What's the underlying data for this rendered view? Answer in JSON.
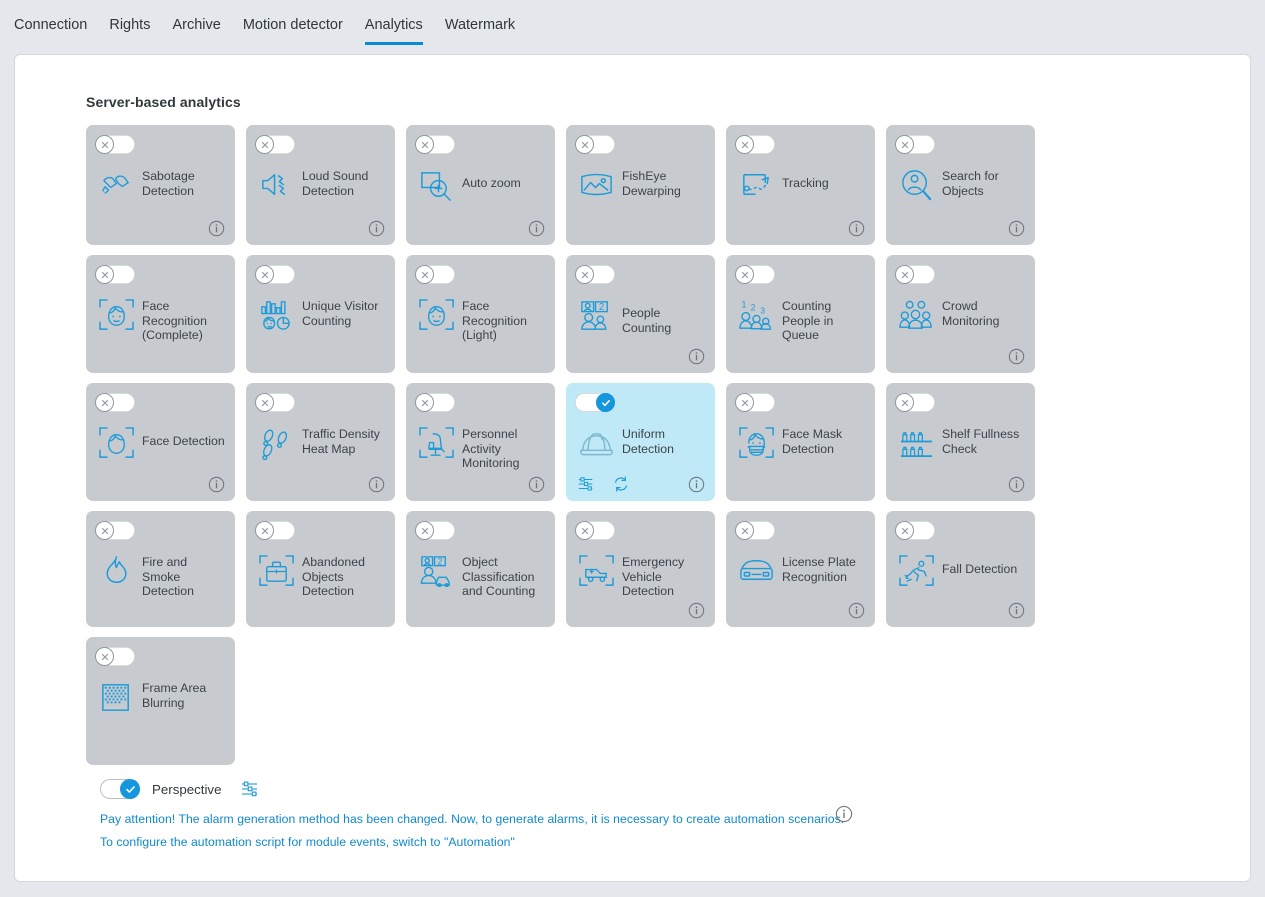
{
  "tabs": [
    {
      "label": "Connection",
      "active": false
    },
    {
      "label": "Rights",
      "active": false
    },
    {
      "label": "Archive",
      "active": false
    },
    {
      "label": "Motion detector",
      "active": false
    },
    {
      "label": "Analytics",
      "active": true
    },
    {
      "label": "Watermark",
      "active": false
    }
  ],
  "section": {
    "title": "Server-based analytics"
  },
  "colors": {
    "accent": "#0a8cd2",
    "icon_blue": "#1d9bd8",
    "card_bg": "#c7cbd0",
    "card_active_bg": "#bfe9f7",
    "page_bg": "#e4e8ec",
    "text": "#3c4248",
    "link": "#1089cc"
  },
  "cards": [
    {
      "id": "sabotage-detection",
      "label": "Sabotage Detection",
      "icon": "sabotage-icon",
      "enabled": false,
      "info": true,
      "settings": false,
      "refresh": false,
      "height": "h120"
    },
    {
      "id": "loud-sound-detection",
      "label": "Loud Sound Detection",
      "icon": "loud-sound-icon",
      "enabled": false,
      "info": true,
      "settings": false,
      "refresh": false,
      "height": "h120"
    },
    {
      "id": "auto-zoom",
      "label": "Auto zoom",
      "icon": "auto-zoom-icon",
      "enabled": false,
      "info": true,
      "settings": false,
      "refresh": false,
      "height": "h120"
    },
    {
      "id": "fisheye-dewarping",
      "label": "FishEye Dewarping",
      "icon": "fisheye-icon",
      "enabled": false,
      "info": false,
      "settings": false,
      "refresh": false,
      "height": "h120"
    },
    {
      "id": "tracking",
      "label": "Tracking",
      "icon": "tracking-icon",
      "enabled": false,
      "info": true,
      "settings": false,
      "refresh": false,
      "height": "h120"
    },
    {
      "id": "search-for-objects",
      "label": "Search for Objects",
      "icon": "search-objects-icon",
      "enabled": false,
      "info": true,
      "settings": false,
      "refresh": false,
      "height": "h120"
    },
    {
      "id": "face-recognition-complete",
      "label": "Face Recognition (Complete)",
      "icon": "face-frame-icon",
      "enabled": false,
      "info": false,
      "settings": false,
      "refresh": false,
      "height": "h118"
    },
    {
      "id": "unique-visitor-counting",
      "label": "Unique Visitor Counting",
      "icon": "unique-visitor-icon",
      "enabled": false,
      "info": false,
      "settings": false,
      "refresh": false,
      "height": "h118"
    },
    {
      "id": "face-recognition-light",
      "label": "Face Recognition (Light)",
      "icon": "face-frame-icon",
      "enabled": false,
      "info": false,
      "settings": false,
      "refresh": false,
      "height": "h118"
    },
    {
      "id": "people-counting",
      "label": "People Counting",
      "icon": "people-counting-icon",
      "enabled": false,
      "info": true,
      "settings": false,
      "refresh": false,
      "height": "h118"
    },
    {
      "id": "counting-people-in-queue",
      "label": "Counting People in Queue",
      "icon": "queue-counting-icon",
      "enabled": false,
      "info": false,
      "settings": false,
      "refresh": false,
      "height": "h118"
    },
    {
      "id": "crowd-monitoring",
      "label": "Crowd Monitoring",
      "icon": "crowd-icon",
      "enabled": false,
      "info": true,
      "settings": false,
      "refresh": false,
      "height": "h118"
    },
    {
      "id": "face-detection",
      "label": "Face Detection",
      "icon": "face-frame-plain-icon",
      "enabled": false,
      "info": true,
      "settings": false,
      "refresh": false,
      "height": "h118"
    },
    {
      "id": "traffic-density-heat-map",
      "label": "Traffic Density Heat Map",
      "icon": "footsteps-icon",
      "enabled": false,
      "info": true,
      "settings": false,
      "refresh": false,
      "height": "h118"
    },
    {
      "id": "personnel-activity-monitoring",
      "label": "Personnel Activity Monitoring",
      "icon": "chair-frame-icon",
      "enabled": false,
      "info": true,
      "settings": false,
      "refresh": false,
      "height": "h118"
    },
    {
      "id": "uniform-detection",
      "label": "Uniform Detection",
      "icon": "helmet-icon",
      "enabled": true,
      "info": true,
      "settings": true,
      "refresh": true,
      "height": "h118"
    },
    {
      "id": "face-mask-detection",
      "label": "Face Mask Detection",
      "icon": "face-mask-icon",
      "enabled": false,
      "info": false,
      "settings": false,
      "refresh": false,
      "height": "h118"
    },
    {
      "id": "shelf-fullness-check",
      "label": "Shelf Fullness Check",
      "icon": "shelf-icon",
      "enabled": false,
      "info": true,
      "settings": false,
      "refresh": false,
      "height": "h118"
    },
    {
      "id": "fire-and-smoke-detection",
      "label": "Fire and Smoke Detection",
      "icon": "flame-icon",
      "enabled": false,
      "info": false,
      "settings": false,
      "refresh": false,
      "height": "h116"
    },
    {
      "id": "abandoned-objects-detection",
      "label": "Abandoned Objects Detection",
      "icon": "suitcase-frame-icon",
      "enabled": false,
      "info": false,
      "settings": false,
      "refresh": false,
      "height": "h116"
    },
    {
      "id": "object-classification-and-counting",
      "label": "Object Classification and Counting",
      "icon": "object-classification-icon",
      "enabled": false,
      "info": false,
      "settings": false,
      "refresh": false,
      "height": "h116"
    },
    {
      "id": "emergency-vehicle-detection",
      "label": "Emergency Vehicle Detection",
      "icon": "ambulance-frame-icon",
      "enabled": false,
      "info": true,
      "settings": false,
      "refresh": false,
      "height": "h116"
    },
    {
      "id": "license-plate-recognition",
      "label": "License Plate Recognition",
      "icon": "car-icon",
      "enabled": false,
      "info": true,
      "settings": false,
      "refresh": false,
      "height": "h116"
    },
    {
      "id": "fall-detection",
      "label": "Fall Detection",
      "icon": "fall-frame-icon",
      "enabled": false,
      "info": true,
      "settings": false,
      "refresh": false,
      "height": "h116"
    },
    {
      "id": "frame-area-blurring",
      "label": "Frame Area Blurring",
      "icon": "blur-icon",
      "enabled": false,
      "info": false,
      "settings": false,
      "refresh": false,
      "height": "h128"
    }
  ],
  "perspective": {
    "label": "Perspective",
    "enabled": true,
    "settings_icon": "sliders-icon"
  },
  "notices": {
    "line1": "Pay attention! The alarm generation method has been changed. Now, to generate alarms, it is necessary to create automation scenarios.",
    "line2": "To configure the automation script for module events, switch to \"Automation\"",
    "info_icon": "info-icon"
  }
}
